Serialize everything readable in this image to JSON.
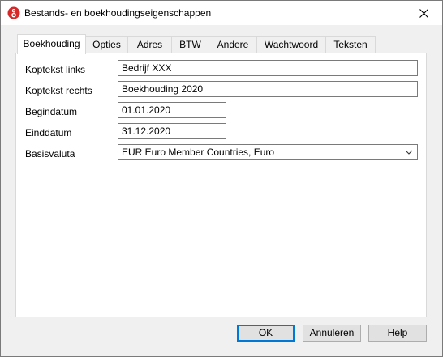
{
  "window": {
    "title": "Bestands- en boekhoudingseigenschappen",
    "close_glyph": "✕"
  },
  "tabs": [
    {
      "label": "Boekhouding",
      "active": true
    },
    {
      "label": "Opties",
      "active": false
    },
    {
      "label": "Adres",
      "active": false
    },
    {
      "label": "BTW",
      "active": false
    },
    {
      "label": "Andere",
      "active": false
    },
    {
      "label": "Wachtwoord",
      "active": false
    },
    {
      "label": "Teksten",
      "active": false
    }
  ],
  "form": {
    "header_left": {
      "label": "Koptekst links",
      "value": "Bedrijf XXX"
    },
    "header_right": {
      "label": "Koptekst rechts",
      "value": "Boekhouding 2020"
    },
    "start_date": {
      "label": "Begindatum",
      "value": "01.01.2020"
    },
    "end_date": {
      "label": "Einddatum",
      "value": "31.12.2020"
    },
    "currency": {
      "label": "Basisvaluta",
      "value": "EUR Euro Member Countries, Euro"
    }
  },
  "buttons": {
    "ok": "OK",
    "cancel": "Annuleren",
    "help": "Help"
  },
  "colors": {
    "app_icon_red": "#d62828",
    "default_button_border": "#0078d7"
  }
}
